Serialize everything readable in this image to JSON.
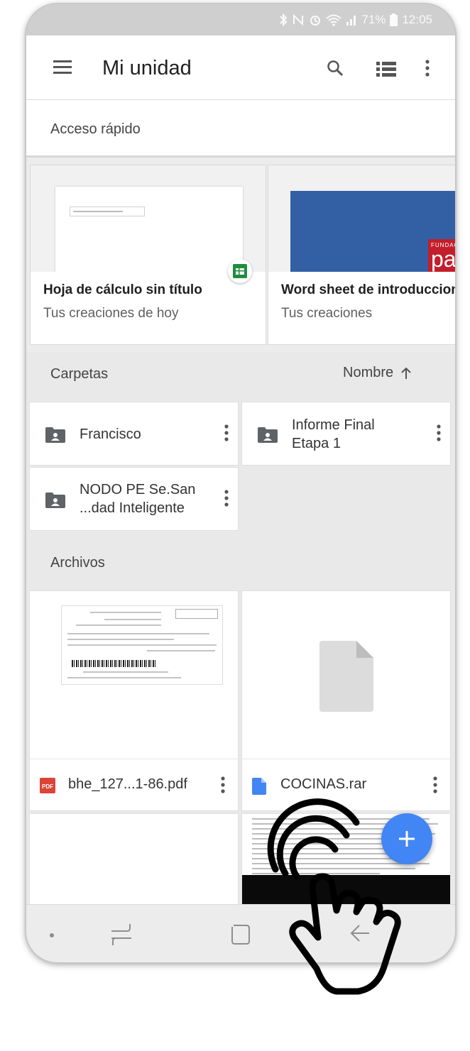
{
  "status_bar": {
    "battery": "71%",
    "time": "12:05"
  },
  "app_bar": {
    "title": "Mi unidad",
    "icons": [
      "menu-icon",
      "search-icon",
      "list-view-icon",
      "more-vert-icon"
    ]
  },
  "quick_access": {
    "header": "Acceso rápido",
    "cards": [
      {
        "name": "Hoja de cálculo sin título",
        "subtitle": "Tus creaciones de hoy",
        "thumb": "spreadsheet",
        "badge": "sheets-icon"
      },
      {
        "name": "Word sheet de introduccion",
        "subtitle": "Tus creaciones",
        "thumb": "slide",
        "logo_small": "FUNDACIÓN",
        "logo_big": "país"
      }
    ]
  },
  "folders": {
    "header": "Carpetas",
    "sort_label": "Nombre",
    "items": [
      {
        "line1": "Francisco",
        "line2": ""
      },
      {
        "line1": "Informe Final",
        "line2": "Etapa 1"
      },
      {
        "line1": "NODO PE Se.San",
        "line2": "...dad Inteligente"
      }
    ]
  },
  "files": {
    "header": "Archivos",
    "items": [
      {
        "name": "bhe_127...1-86.pdf",
        "type": "pdf",
        "type_label": "PDF"
      },
      {
        "name": "COCINAS.rar",
        "type": "doc"
      }
    ]
  },
  "fab": {
    "icon": "plus-icon"
  },
  "nav_bar": {
    "icons": [
      "nav-dot",
      "recents-icon",
      "home-icon",
      "back-icon"
    ]
  },
  "colors": {
    "fab": "#4285f4",
    "sheets": "#1e8e3e",
    "pdf": "#db4437",
    "doc": "#4285f4",
    "folder": "#5f6368",
    "logo": "#c31e2c",
    "slide": "#335fa5"
  }
}
